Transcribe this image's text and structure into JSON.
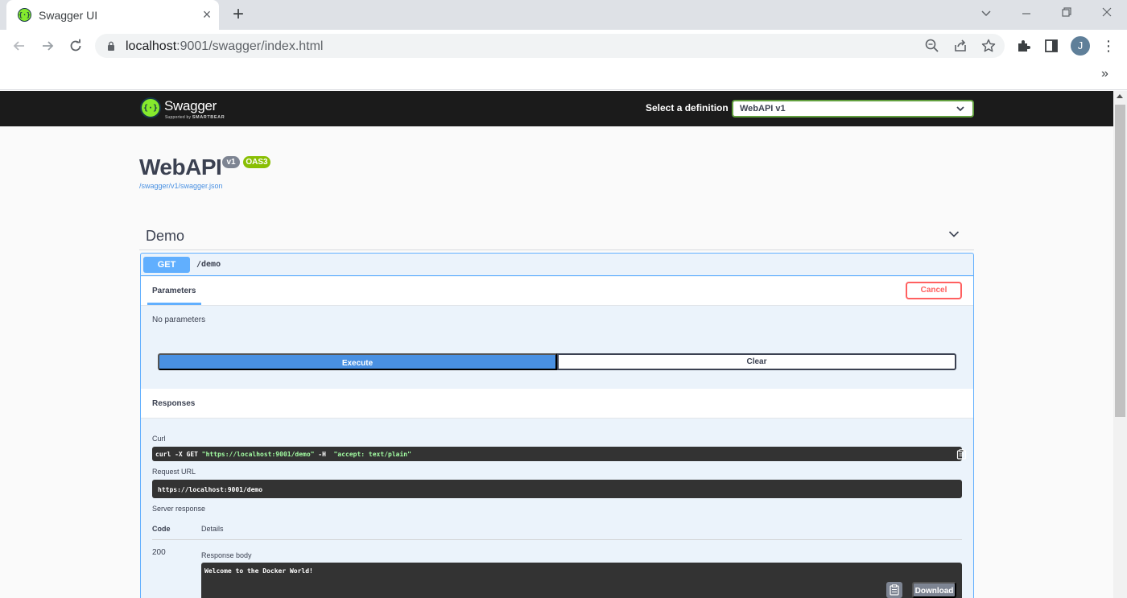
{
  "browser": {
    "tab_title": "Swagger UI",
    "url_host": "localhost",
    "url_rest": ":9001/swagger/index.html",
    "bookmarks_more": "»",
    "profile_initial": "J"
  },
  "topbar": {
    "logo_name": "Swagger",
    "logo_sub_prefix": "Supported by",
    "logo_sub_brand": "SMARTBEAR",
    "definition_label": "Select a definition",
    "definition_selected": "WebAPI v1"
  },
  "info": {
    "title": "WebAPI",
    "version_badge": "v1",
    "oas_badge": "OAS3",
    "spec_url": "/swagger/v1/swagger.json"
  },
  "section": {
    "name": "Demo"
  },
  "operation": {
    "method": "GET",
    "path": "/demo",
    "parameters_tab": "Parameters",
    "cancel_label": "Cancel",
    "no_params": "No parameters",
    "execute_label": "Execute",
    "clear_label": "Clear"
  },
  "responses": {
    "title": "Responses",
    "curl_label": "Curl",
    "curl_cmd": "curl -X GET ",
    "curl_url": "\"https://localhost:9001/demo\"",
    "curl_flag": " -H  ",
    "curl_header": "\"accept: text/plain\"",
    "request_url_label": "Request URL",
    "request_url": "https://localhost:9001/demo",
    "server_response_label": "Server response",
    "col_code": "Code",
    "col_details": "Details",
    "status_code": "200",
    "response_body_label": "Response body",
    "response_body": "Welcome to the Docker World!",
    "download_label": "Download"
  },
  "colors": {
    "get_blue": "#61affe",
    "execute_blue": "#4990e2",
    "swagger_green": "#85ea2d",
    "cancel_red": "#ff6060",
    "topbar_bg": "#1b1b1b"
  }
}
